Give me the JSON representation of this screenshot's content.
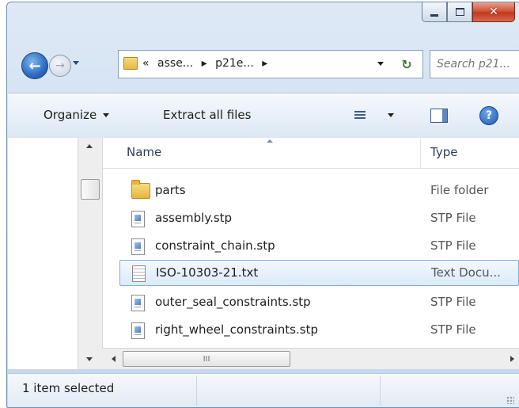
{
  "window": {
    "minimize_icon": "minimize-icon",
    "maximize_icon": "maximize-icon",
    "close_icon": "close-icon"
  },
  "address_bar": {
    "prefix": "«",
    "segments": [
      "asse...",
      "p21e..."
    ],
    "separator": "▸",
    "search_placeholder": "Search p21..."
  },
  "command_bar": {
    "organize_label": "Organize",
    "extract_label": "Extract all files"
  },
  "columns": {
    "name": "Name",
    "type": "Type"
  },
  "files": [
    {
      "name": "parts",
      "type": "File folder",
      "icon": "folder-icon"
    },
    {
      "name": "assembly.stp",
      "type": "STP File",
      "icon": "stp-file-icon"
    },
    {
      "name": "constraint_chain.stp",
      "type": "STP File",
      "icon": "stp-file-icon"
    },
    {
      "name": "ISO-10303-21.txt",
      "type": "Text Docu...",
      "icon": "text-file-icon",
      "selected": true
    },
    {
      "name": "outer_seal_constraints.stp",
      "type": "STP File",
      "icon": "stp-file-icon"
    },
    {
      "name": "right_wheel_constraints.stp",
      "type": "STP File",
      "icon": "stp-file-icon"
    }
  ],
  "hscroll_grip": "III",
  "status": {
    "text": "1 item selected"
  },
  "colors": {
    "selection_border": "#84acdd",
    "close_button": "#c2381c",
    "accent_blue": "#2b6bc0"
  }
}
